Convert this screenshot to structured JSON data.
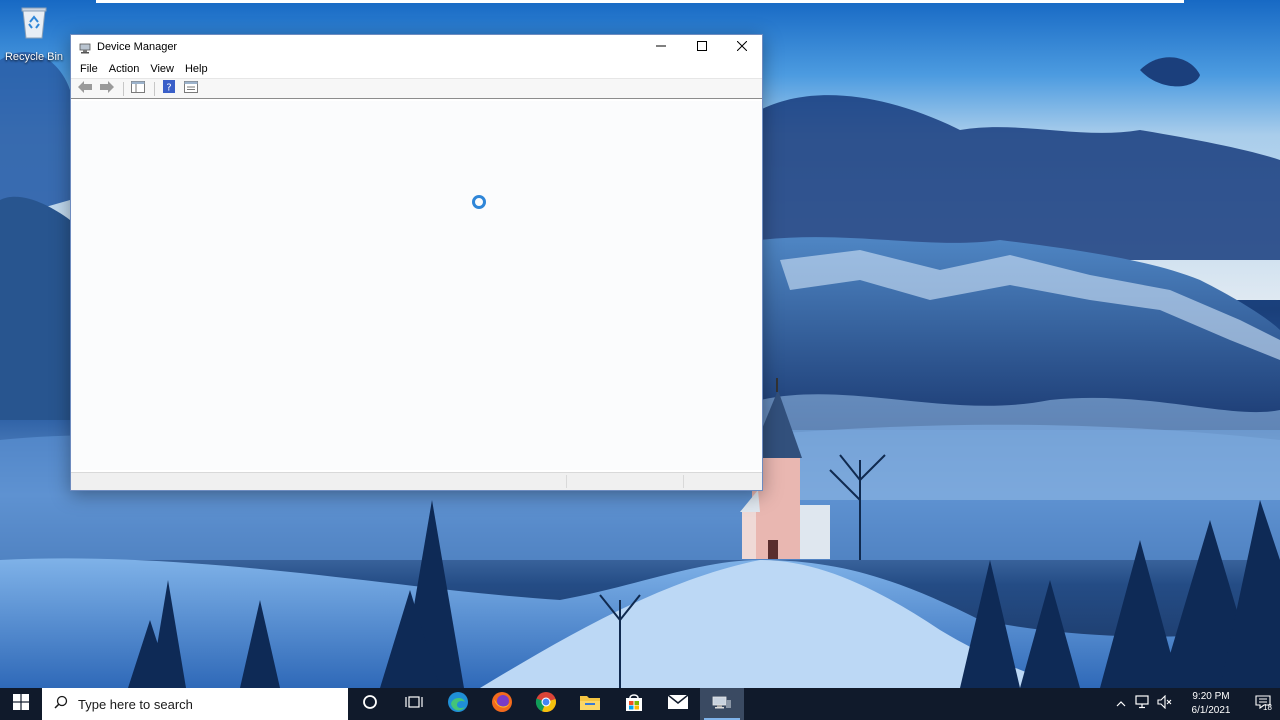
{
  "desktop": {
    "icons": [
      {
        "label": "Recycle Bin",
        "icon": "recycle-bin-icon"
      }
    ]
  },
  "window": {
    "title": "Device Manager",
    "icon": "device-manager-icon",
    "controls": {
      "minimize": "minimize-icon",
      "maximize": "maximize-icon",
      "close": "close-icon"
    },
    "menu": [
      {
        "label": "File"
      },
      {
        "label": "Action"
      },
      {
        "label": "View"
      },
      {
        "label": "Help"
      }
    ],
    "toolbar": [
      {
        "icon": "back-arrow-icon"
      },
      {
        "icon": "forward-arrow-icon"
      },
      {
        "icon": "show-hide-tree-icon"
      },
      {
        "icon": "help-icon"
      },
      {
        "icon": "properties-icon"
      }
    ],
    "content": {
      "state": "loading",
      "spinner_icon": "loading-spinner-icon"
    }
  },
  "taskbar": {
    "search": {
      "placeholder": "Type here to search",
      "icon": "search-icon"
    },
    "apps": [
      {
        "icon": "cortana-icon"
      },
      {
        "icon": "task-view-icon"
      },
      {
        "icon": "edge-icon"
      },
      {
        "icon": "firefox-icon"
      },
      {
        "icon": "chrome-icon"
      },
      {
        "icon": "file-explorer-icon"
      },
      {
        "icon": "store-icon"
      },
      {
        "icon": "mail-icon"
      },
      {
        "icon": "device-manager-icon",
        "active": true
      }
    ],
    "tray": {
      "icons": [
        "chevron-up-icon",
        "network-icon",
        "volume-muted-icon"
      ],
      "time": "9:20 PM",
      "date": "6/1/2021",
      "notification_count": "18"
    }
  },
  "colors": {
    "accent": "#2f86d8",
    "taskbar": "#101a2b",
    "window_border": "#6d8bbf"
  }
}
